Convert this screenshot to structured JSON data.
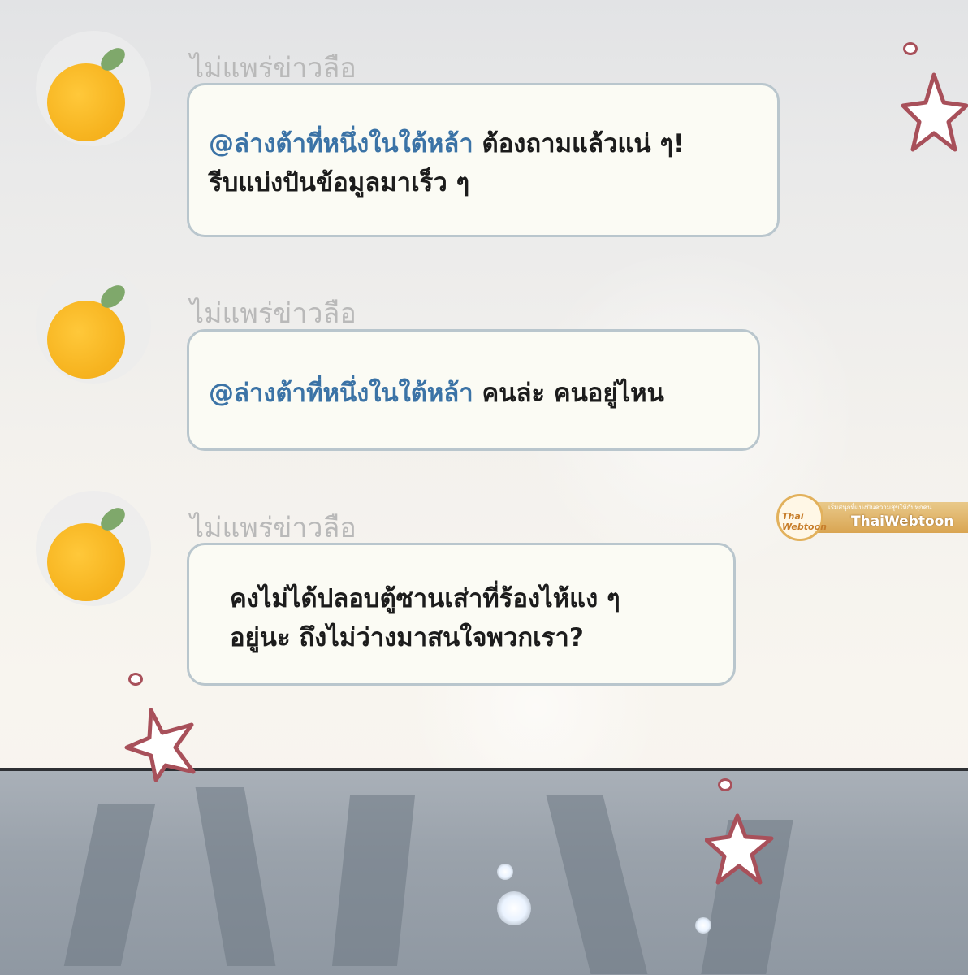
{
  "messages": [
    {
      "sender": "ไม่แพร่ข่าวลือ",
      "mention": "@ล่างต้าที่หนึ่งในใต้หล้า",
      "line1_rest": " ต้องถามแล้วแน่ ๆ!",
      "line2": "รีบแบ่งปันข้อมูลมาเร็ว ๆ",
      "avatar_icon": "orange-fruit-icon"
    },
    {
      "sender": "ไม่แพร่ข่าวลือ",
      "mention": "@ล่างต้าที่หนึ่งในใต้หล้า",
      "line1_rest": " คนล่ะ คนอยู่ไหน",
      "avatar_icon": "orange-fruit-icon"
    },
    {
      "sender": "ไม่แพร่ข่าวลือ",
      "line1": "คงไม่ได้ปลอบตู้ซานเส่าที่ร้องไห้แง ๆ",
      "line2": "อยู่นะ ถึงไม่ว่างมาสนใจพวกเรา?",
      "avatar_icon": "orange-fruit-icon"
    }
  ],
  "watermark": {
    "logo": "Thai Webtoon",
    "tagline": "เริ่มสนุกที่แบ่งปันความสุขให้กับทุกคน",
    "name": "ThaiWebtoon"
  },
  "colors": {
    "mention": "#3b73a6",
    "sender": "#b9b9b9",
    "bubble_border": "#b9c6cd",
    "bubble_fill": "#fbfbf4",
    "star_outline": "#a8505a"
  }
}
